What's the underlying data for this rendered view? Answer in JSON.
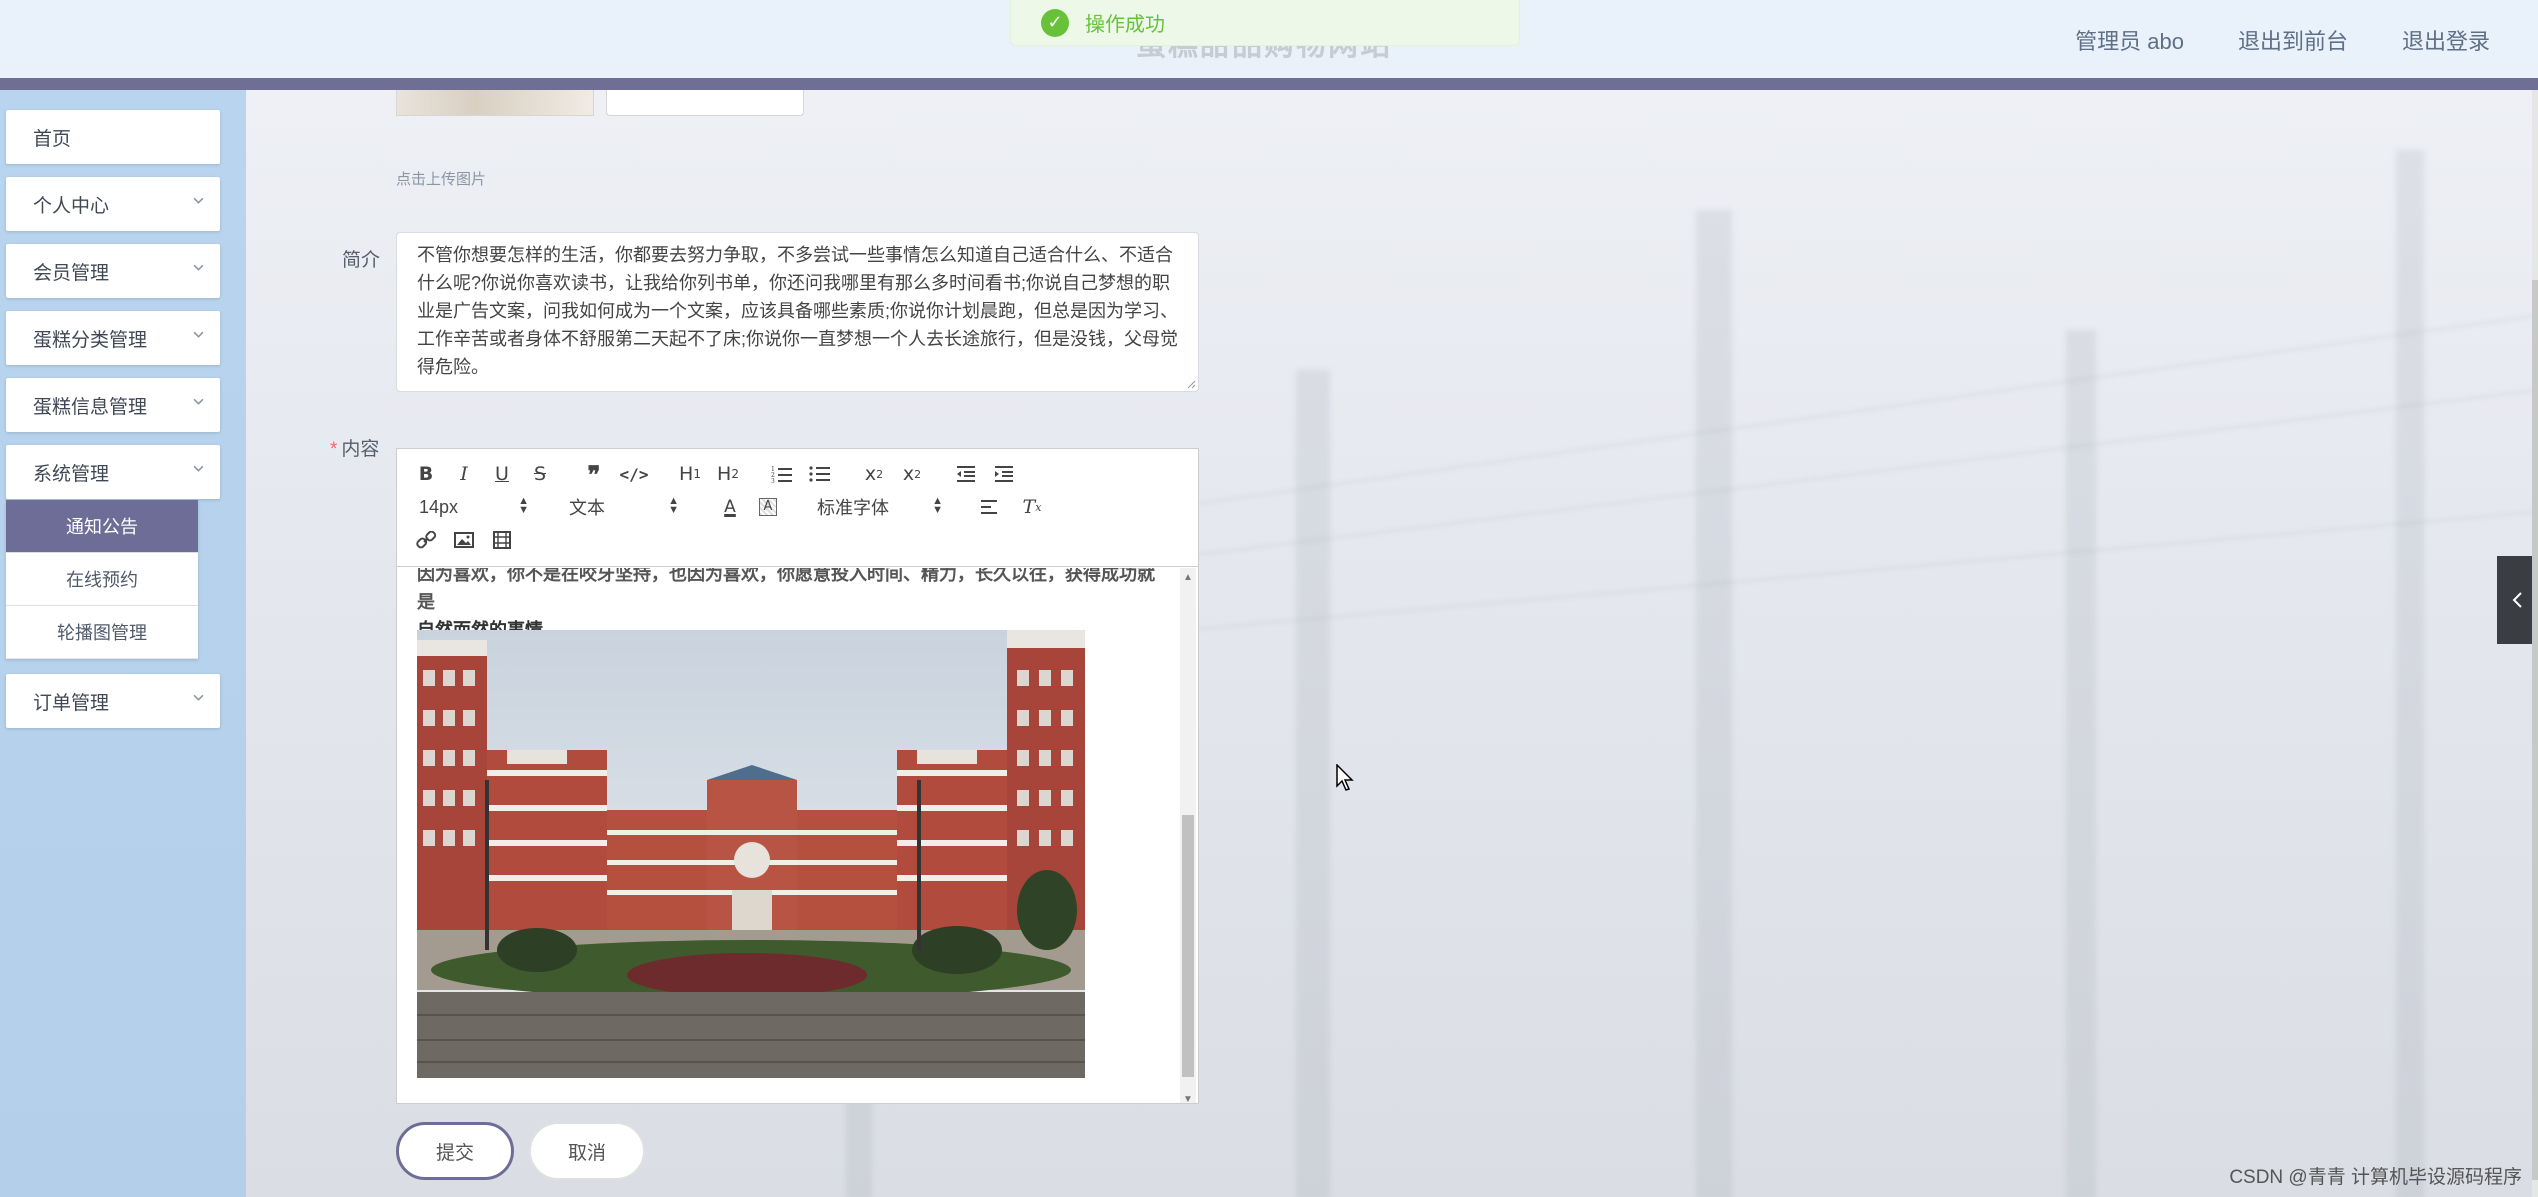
{
  "header": {
    "site_title": "蛋糕甜品购物网站",
    "toast": "操作成功",
    "links": [
      "管理员 abo",
      "退出到前台",
      "退出登录"
    ]
  },
  "sidebar": {
    "items": [
      {
        "label": "首页"
      },
      {
        "label": "个人中心"
      },
      {
        "label": "会员管理"
      },
      {
        "label": "蛋糕分类管理"
      },
      {
        "label": "蛋糕信息管理"
      },
      {
        "label": "系统管理"
      },
      {
        "label": "订单管理"
      }
    ],
    "sub_items": [
      "通知公告",
      "在线预约",
      "轮播图管理"
    ]
  },
  "form": {
    "upload_hint": "点击上传图片",
    "intro_label": "简介",
    "intro_text": "不管你想要怎样的生活，你都要去努力争取，不多尝试一些事情怎么知道自己适合什么、不适合什么呢?你说你喜欢读书，让我给你列书单，你还问我哪里有那么多时间看书;你说自己梦想的职业是广告文案，问我如何成为一个文案，应该具备哪些素质;你说你计划晨跑，但总是因为学习、工作辛苦或者身体不舒服第二天起不了床;你说你一直梦想一个人去长途旅行，但是没钱，父母觉得危险。",
    "content_label": "内容",
    "editor": {
      "font_size": "14px",
      "block_type": "文本",
      "font_family": "标准字体",
      "text_cut": "因为喜欢，你不是在咬牙坚持，也因为喜欢，你愿意投入时间、精力，长久以往，获得成功就是",
      "text_line": "自然而然的事情。"
    },
    "submit_label": "提交",
    "cancel_label": "取消"
  },
  "watermark": "CSDN @青青  计算机毕设源码程序",
  "colors": {
    "accent": "#6e6d97",
    "header_bg": "#e9f2fb",
    "sidebar_bg": "#b8d4ee",
    "success": "#67c23a"
  }
}
